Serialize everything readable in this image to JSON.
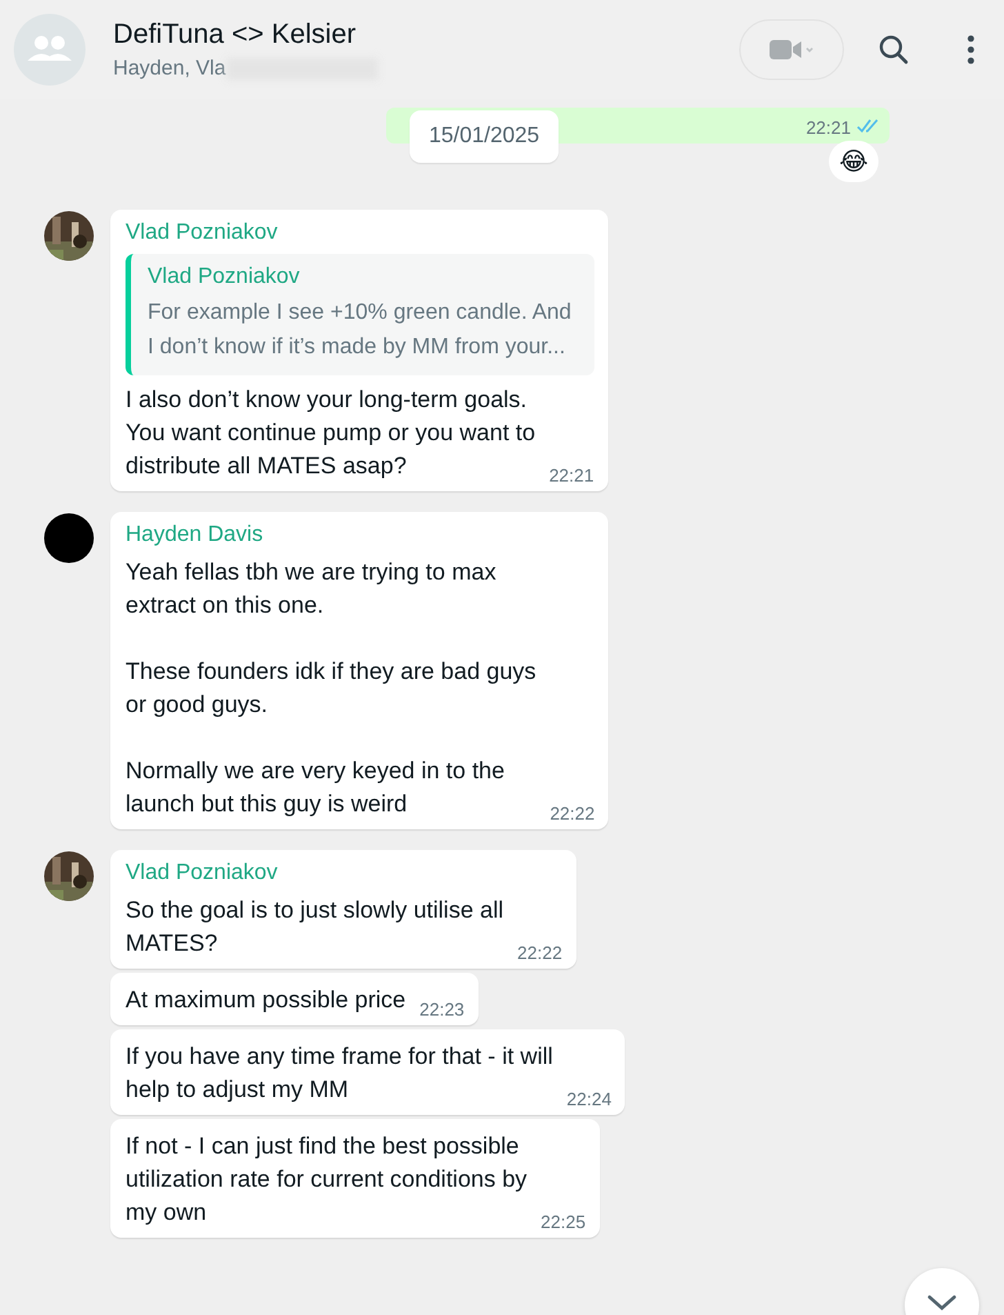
{
  "header": {
    "title": "DefiTuna <> Kelsier",
    "subtitle": "Hayden, Vla"
  },
  "top_message": {
    "time": "22:21",
    "read": true,
    "reaction": "😂"
  },
  "date_chip": "15/01/2025",
  "groups": [
    {
      "messages": [
        {
          "sender": "Vlad Pozniakov",
          "quote": {
            "sender": "Vlad Pozniakov",
            "text": "For example I see +10% green candle. And\nI don’t know if it’s made by MM from your..."
          },
          "text": "I also don’t know your long-term goals.\nYou want continue pump or you want to\ndistribute all MATES asap?",
          "time": "22:21"
        }
      ]
    },
    {
      "avatar": {
        "kind": "plain"
      },
      "messages": [
        {
          "sender": "Hayden Davis",
          "text": "Yeah fellas tbh we are trying to max\nextract on this one.\n\nThese founders idk if they are bad guys\nor good guys.\n\nNormally we are very keyed in to the\nlaunch but this guy is weird",
          "time": "22:22"
        }
      ]
    },
    {
      "messages": [
        {
          "sender": "Vlad Pozniakov",
          "text": "So the goal is to just slowly utilise all\nMATES?",
          "time": "22:22"
        },
        {
          "text": "At maximum possible price",
          "time": "22:23"
        },
        {
          "text": "If you have any time frame for that - it will\nhelp to adjust my MM",
          "time": "22:24"
        },
        {
          "text": "If not - I can just find the best possible\nutilization rate for current conditions by\nmy own",
          "time": "22:25"
        }
      ]
    }
  ]
}
